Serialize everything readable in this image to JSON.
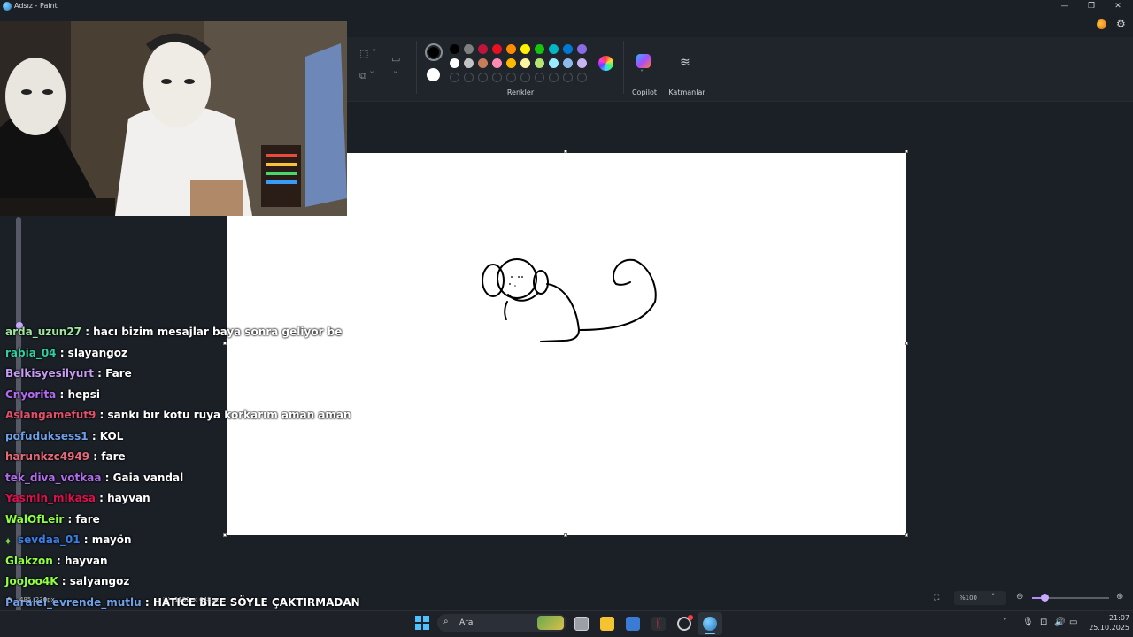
{
  "window": {
    "title": "Adsız - Paint",
    "minimize_glyph": "—",
    "maximize_glyph": "❐",
    "close_glyph": "✕"
  },
  "ribbon": {
    "colors_label": "Renkler",
    "copilot_label": "Copilot",
    "layers_label": "Katmanlar",
    "current_color_1": "#000000",
    "current_color_2": "#ffffff",
    "palette_row1": [
      "#000000",
      "#7f7f7f",
      "#c0143c",
      "#e81123",
      "#ff8c00",
      "#fff100",
      "#16c60c",
      "#00b7c3",
      "#0078d4",
      "#886ce4"
    ],
    "palette_row2": [
      "#ffffff",
      "#c3c3c3",
      "#c87d5a",
      "#ff8ab4",
      "#ffb900",
      "#fff5a0",
      "#b4e474",
      "#99ebff",
      "#8fb9e8",
      "#c8b4f0"
    ],
    "palette_row3_count": 10
  },
  "chat": [
    {
      "user": "arda_uzun27",
      "user_color": "#9fe89f",
      "message": "hacı bizim mesajlar baya sonra geliyor be"
    },
    {
      "user": "rabia_04",
      "user_color": "#2ed1a0",
      "message": "slayangoz"
    },
    {
      "user": "Belkisyesilyurt",
      "user_color": "#c59cf2",
      "message": "Fare"
    },
    {
      "user": "Cnyorita",
      "user_color": "#b36cf0",
      "message": "hepsi"
    },
    {
      "user": "Aslangamefut9",
      "user_color": "#e0506a",
      "message": "sankı bır kotu ruya korkarım aman aman"
    },
    {
      "user": "pofuduksess1",
      "user_color": "#6fa0e8",
      "message": "KOL"
    },
    {
      "user": "harunkzc4949",
      "user_color": "#e86a7a",
      "message": "fare"
    },
    {
      "user": "tek_diva_votkaa",
      "user_color": "#b36cf0",
      "message": "Gaia vandal"
    },
    {
      "user": "Yasmin_mikasa",
      "user_color": "#e01050",
      "message": "hayvan"
    },
    {
      "user": "WalOfLeir",
      "user_color": "#8fff3f",
      "message": "fare"
    },
    {
      "user": "sevdaa_01",
      "user_color": "#3a7fe8",
      "message": "mayön"
    },
    {
      "user": "Glakzon",
      "user_color": "#8fff3f",
      "message": "hayvan"
    },
    {
      "user": "JooJoo4K",
      "user_color": "#8fff3f",
      "message": "salyangoz"
    },
    {
      "user": "Paralel_evrende_mutlu",
      "user_color": "#6fa0e8",
      "message": "HATICE BIZE SÖYLE ÇAKTIRMADAN"
    }
  ],
  "chat_separator": " : ",
  "statusbar": {
    "cursor_pos": "495, 230px",
    "canvas_size": "1152 × 648px",
    "zoom": "%100"
  },
  "taskbar": {
    "search_placeholder": "Ara",
    "time": "21:07",
    "date": "25.10.2025"
  }
}
